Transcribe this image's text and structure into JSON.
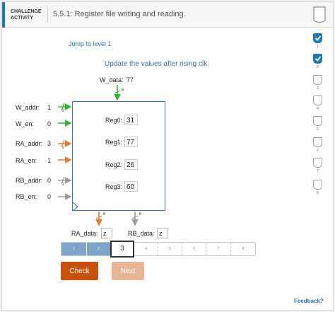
{
  "header": {
    "label_line1": "CHALLENGE",
    "label_line2": "ACTIVITY",
    "title": "5.5.1: Register file writing and reading."
  },
  "levels": [
    {
      "num": "1",
      "done": true
    },
    {
      "num": "2",
      "done": true
    },
    {
      "num": "3",
      "done": false
    },
    {
      "num": "4",
      "done": false
    },
    {
      "num": "5",
      "done": false
    },
    {
      "num": "6",
      "done": false
    },
    {
      "num": "7",
      "done": false
    },
    {
      "num": "8",
      "done": false
    }
  ],
  "jump_link": "Jump to level 1",
  "instruction": "Update the values after rising clk.",
  "w_data": {
    "label": "W_data:",
    "value": "77",
    "width": "8"
  },
  "inputs": {
    "w_addr": {
      "label": "W_addr:",
      "value": "1",
      "width": "2"
    },
    "w_en": {
      "label": "W_en:",
      "value": "0"
    },
    "ra_addr": {
      "label": "RA_addr:",
      "value": "3",
      "width": "2"
    },
    "ra_en": {
      "label": "RA_en:",
      "value": "1"
    },
    "rb_addr": {
      "label": "RB_addr:",
      "value": "0",
      "width": "2"
    },
    "rb_en": {
      "label": "RB_en:",
      "value": "0"
    }
  },
  "registers": [
    {
      "label": "Reg0:",
      "value": "31"
    },
    {
      "label": "Reg1:",
      "value": "77"
    },
    {
      "label": "Reg2:",
      "value": "26"
    },
    {
      "label": "Reg3:",
      "value": "60"
    }
  ],
  "outputs": {
    "ra_data": {
      "label": "RA_data:",
      "value": "z",
      "width": "8"
    },
    "rb_data": {
      "label": "RB_data:",
      "value": "z",
      "width": "8"
    }
  },
  "progress": [
    "1",
    "2",
    "3",
    "4",
    "5",
    "6",
    "7",
    "8"
  ],
  "buttons": {
    "check": "Check",
    "next": "Next"
  },
  "feedback": "Feedback?",
  "colors": {
    "accent": "#1f79b8",
    "write": "#2eb82e",
    "ra": "#e07b30",
    "rb": "#9a9a9a",
    "check": "#c8520b",
    "next": "#e8b594"
  }
}
